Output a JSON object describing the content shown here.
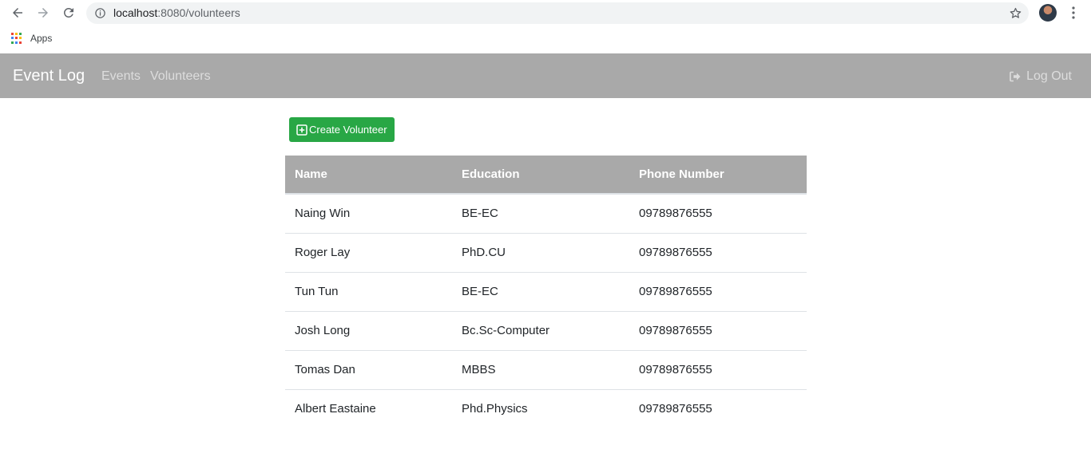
{
  "browser": {
    "url_host": "localhost",
    "url_port_path": ":8080/volunteers",
    "bookmarks": {
      "apps_label": "Apps"
    }
  },
  "navbar": {
    "brand": "Event Log",
    "links": [
      "Events",
      "Volunteers"
    ],
    "logout_label": "Log Out"
  },
  "actions": {
    "create_label": "Create Volunteer"
  },
  "table": {
    "headers": [
      "Name",
      "Education",
      "Phone Number"
    ],
    "rows": [
      [
        "Naing Win",
        "BE-EC",
        "09789876555"
      ],
      [
        "Roger Lay",
        "PhD.CU",
        "09789876555"
      ],
      [
        "Tun Tun",
        "BE-EC",
        "09789876555"
      ],
      [
        "Josh Long",
        "Bc.Sc-Computer",
        "09789876555"
      ],
      [
        "Tomas Dan",
        "MBBS",
        "09789876555"
      ],
      [
        "Albert Eastaine",
        "Phd.Physics",
        "09789876555"
      ]
    ]
  },
  "colors": {
    "navbar_bg": "#a9a9a9",
    "create_button_bg": "#28a745",
    "table_header_bg": "#a9a9a9"
  },
  "icons": {
    "back": "arrow-left-icon",
    "forward": "arrow-right-icon",
    "reload": "reload-icon",
    "info": "info-icon",
    "star": "star-icon",
    "menu": "kebab-menu-icon",
    "apps": "apps-grid-icon",
    "logout": "sign-out-icon",
    "create": "plus-square-icon"
  }
}
